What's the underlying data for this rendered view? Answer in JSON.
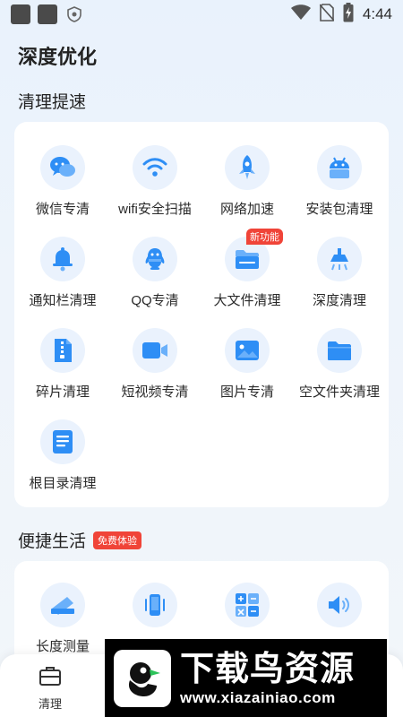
{
  "status_bar": {
    "time": "4:44",
    "icons": [
      "app-square-icon",
      "app-square-icon",
      "shield-icon",
      "wifi-signal-icon",
      "no-sim-icon",
      "battery-charging-icon"
    ]
  },
  "page_title": "深度优化",
  "sections": {
    "cleanup": {
      "title": "清理提速",
      "tools": [
        {
          "label": "微信专清",
          "icon": "wechat-icon"
        },
        {
          "label": "wifi安全扫描",
          "icon": "wifi-icon"
        },
        {
          "label": "网络加速",
          "icon": "rocket-icon"
        },
        {
          "label": "安装包清理",
          "icon": "android-icon"
        },
        {
          "label": "通知栏清理",
          "icon": "bell-icon"
        },
        {
          "label": "QQ专清",
          "icon": "qq-penguin-icon"
        },
        {
          "label": "大文件清理",
          "icon": "folder-icon",
          "badge": "新功能"
        },
        {
          "label": "深度清理",
          "icon": "deep-clean-icon"
        },
        {
          "label": "碎片清理",
          "icon": "zip-file-icon"
        },
        {
          "label": "短视频专清",
          "icon": "video-camera-icon"
        },
        {
          "label": "图片专清",
          "icon": "image-icon"
        },
        {
          "label": "空文件夹清理",
          "icon": "empty-folder-icon"
        },
        {
          "label": "根目录清理",
          "icon": "document-icon"
        }
      ]
    },
    "life": {
      "title": "便捷生活",
      "badge": "免费体验",
      "tools": [
        {
          "label": "长度测量",
          "icon": "ruler-icon"
        },
        {
          "label": "",
          "icon": "phone-shake-icon"
        },
        {
          "label": "",
          "icon": "calculator-icon"
        },
        {
          "label": "",
          "icon": "speaker-icon"
        }
      ]
    }
  },
  "bottom_nav": {
    "items": [
      {
        "label": "清理",
        "icon": "toolbox-icon"
      }
    ]
  },
  "watermark": {
    "title": "下载鸟资源",
    "url": "www.xiazainiao.com"
  },
  "colors": {
    "accent": "#2e8ef5",
    "badge_red": "#f04438",
    "icon_bg": "#eaf2fd"
  }
}
